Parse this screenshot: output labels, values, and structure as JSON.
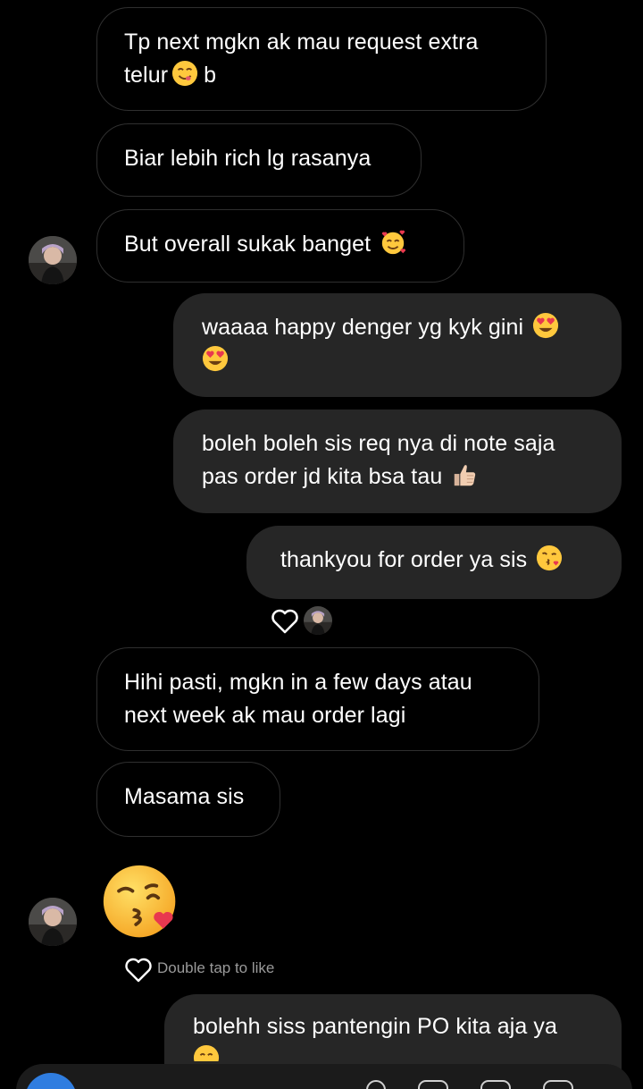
{
  "messages": [
    {
      "side": "in",
      "text_l1": "Tp next mgkn ak mau request extra",
      "text_l2": "telur",
      "tail": "b",
      "emoji": "yum-face-icon"
    },
    {
      "side": "in",
      "text": "Biar lebih rich lg rasanya"
    },
    {
      "side": "in",
      "text": "But overall sukak banget",
      "emoji": "smiling-face-with-hearts-icon"
    },
    {
      "side": "out",
      "text_l1": "waaaa happy denger yg kyk gini",
      "emoji": "heart-eyes-icon"
    },
    {
      "side": "out",
      "text_l1": "boleh boleh sis req nya di note saja",
      "text_l2": "pas order jd kita bsa tau",
      "emoji": "thumbs-up-icon"
    },
    {
      "side": "out",
      "text": "thankyou for order ya sis",
      "emoji": "face-blowing-kiss-icon"
    },
    {
      "side": "in",
      "text_l1": "Hihi pasti, mgkn in a few days atau",
      "text_l2": "next week ak mau order lagi"
    },
    {
      "side": "in",
      "text": "Masama sis"
    },
    {
      "side": "in",
      "emoji": "face-blowing-kiss-icon",
      "large": true
    },
    {
      "side": "out",
      "text": "bolehh siss pantengin PO kita aja ya",
      "emoji": "smiling-face-icon"
    }
  ],
  "reaction": {
    "icon": "heart-outline-icon"
  },
  "double_tap": {
    "label": "Double tap to like"
  },
  "colors": {
    "background": "#000000",
    "outgoing_bubble": "#262626",
    "incoming_border": "#2f2f2f",
    "accent": "#2f7de0"
  }
}
